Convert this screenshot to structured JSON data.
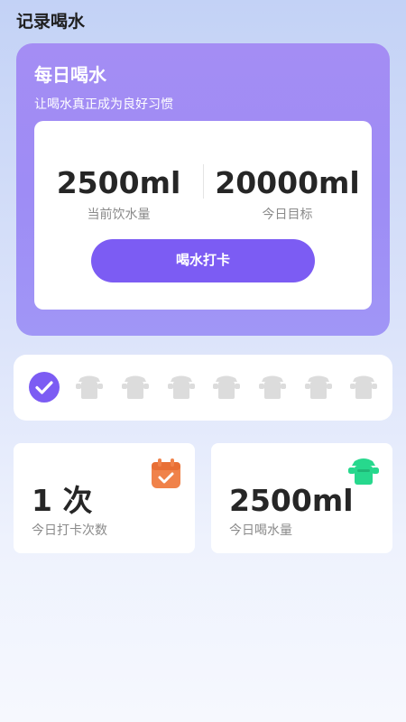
{
  "header": {
    "title": "记录喝水"
  },
  "hero": {
    "title": "每日喝水",
    "subtitle": "让喝水真正成为良好习惯",
    "current": {
      "value": "2500ml",
      "label": "当前饮水量"
    },
    "goal": {
      "value": "20000ml",
      "label": "今日目标"
    },
    "checkin_label": "喝水打卡",
    "accent_color": "#7c5cf3"
  },
  "cups": {
    "total": 8,
    "checked": 1,
    "icon": "cup-icon",
    "check_icon": "check-circle-icon"
  },
  "cards": {
    "checkins": {
      "value": "1 次",
      "label": "今日打卡次数",
      "icon": "calendar-check-icon",
      "icon_color": "#f0824a"
    },
    "water": {
      "value": "2500ml",
      "label": "今日喝水量",
      "icon": "cup-icon",
      "icon_color": "#27d88d"
    }
  }
}
